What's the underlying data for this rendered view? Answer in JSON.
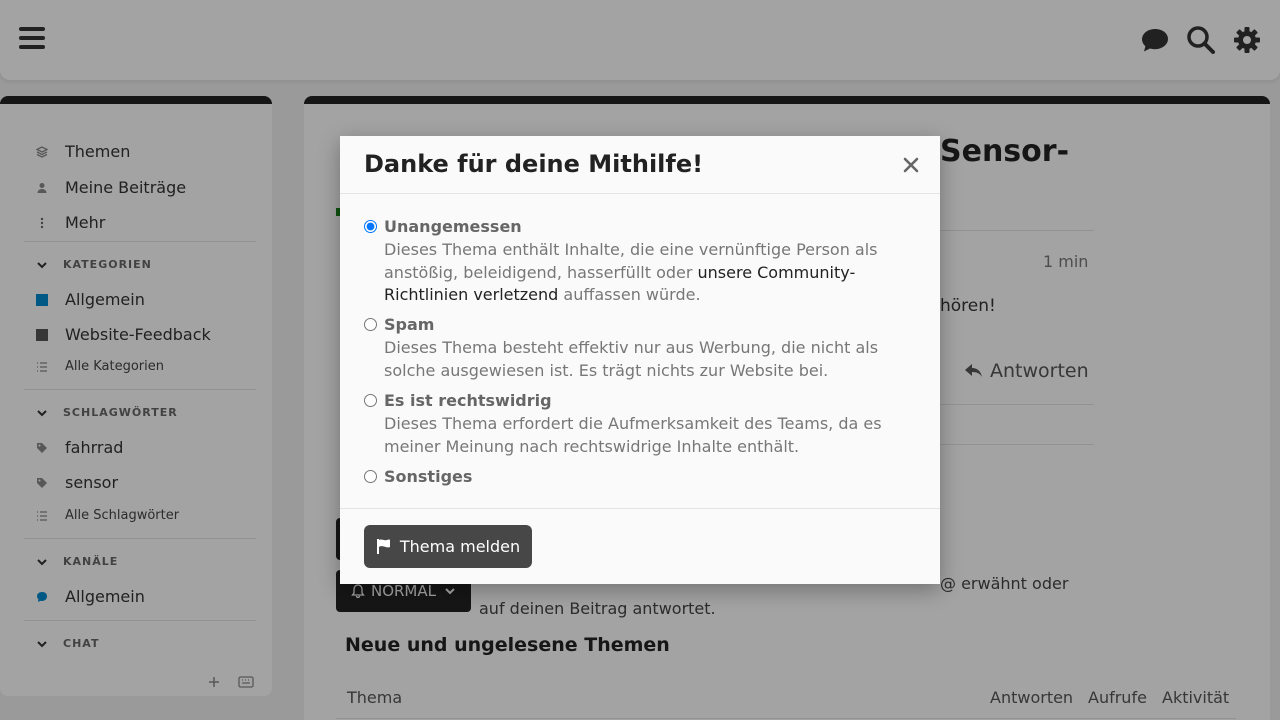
{
  "header": {
    "icons": [
      "hamburger-icon",
      "chat-bubble-icon",
      "search-icon",
      "gear-icon"
    ]
  },
  "sidebar": {
    "items": [
      {
        "label": "Themen",
        "icon": "layers-icon"
      },
      {
        "label": "Meine Beiträge",
        "icon": "user-icon"
      },
      {
        "label": "Mehr",
        "icon": "more-vertical-icon"
      }
    ],
    "categories_heading": "KATEGORIEN",
    "categories": [
      {
        "label": "Allgemein",
        "color": "#0088cc"
      },
      {
        "label": "Website-Feedback",
        "color": "#555555"
      }
    ],
    "all_categories": "Alle Kategorien",
    "tags_heading": "SCHLAGWÖRTER",
    "tags": [
      "fahrrad",
      "sensor"
    ],
    "all_tags": "Alle Schlagwörter",
    "channels_heading": "KANÄLE",
    "channels": [
      {
        "label": "Allgemein",
        "color": "#0088cc"
      }
    ],
    "chat_heading": "CHAT"
  },
  "main": {
    "title_fragment": "Sensor-",
    "time": "1 min",
    "text_fragment": "hören!",
    "reply_label": "Antworten",
    "notification_level": "NORMAL",
    "notification_text_fragment": "@ erwähnt oder",
    "notification_text_line2": "auf deinen Beitrag antwortet.",
    "new_topics_heading": "Neue und ungelesene Themen",
    "table_headers": {
      "topic": "Thema",
      "replies": "Antworten",
      "views": "Aufrufe",
      "activity": "Aktivität"
    }
  },
  "modal": {
    "title": "Danke für deine Mithilfe!",
    "options": [
      {
        "label": "Unangemessen",
        "checked": true,
        "desc_before": "Dieses Thema enthält Inhalte, die eine vernünftige Person als anstößig, beleidigend, hasserfüllt oder ",
        "desc_link": "unsere Community-Richtlinien verletzend",
        "desc_after": " auffassen würde."
      },
      {
        "label": "Spam",
        "checked": false,
        "desc": "Dieses Thema besteht effektiv nur aus Werbung, die nicht als solche ausgewiesen ist. Es trägt nichts zur Website bei."
      },
      {
        "label": "Es ist rechtswidrig",
        "checked": false,
        "desc": "Dieses Thema erfordert die Aufmerksamkeit des Teams, da es meiner Meinung nach rechtswidrige Inhalte enthält."
      },
      {
        "label": "Sonstiges",
        "checked": false
      }
    ],
    "submit_label": "Thema melden",
    "submit_icon": "flag-icon"
  }
}
